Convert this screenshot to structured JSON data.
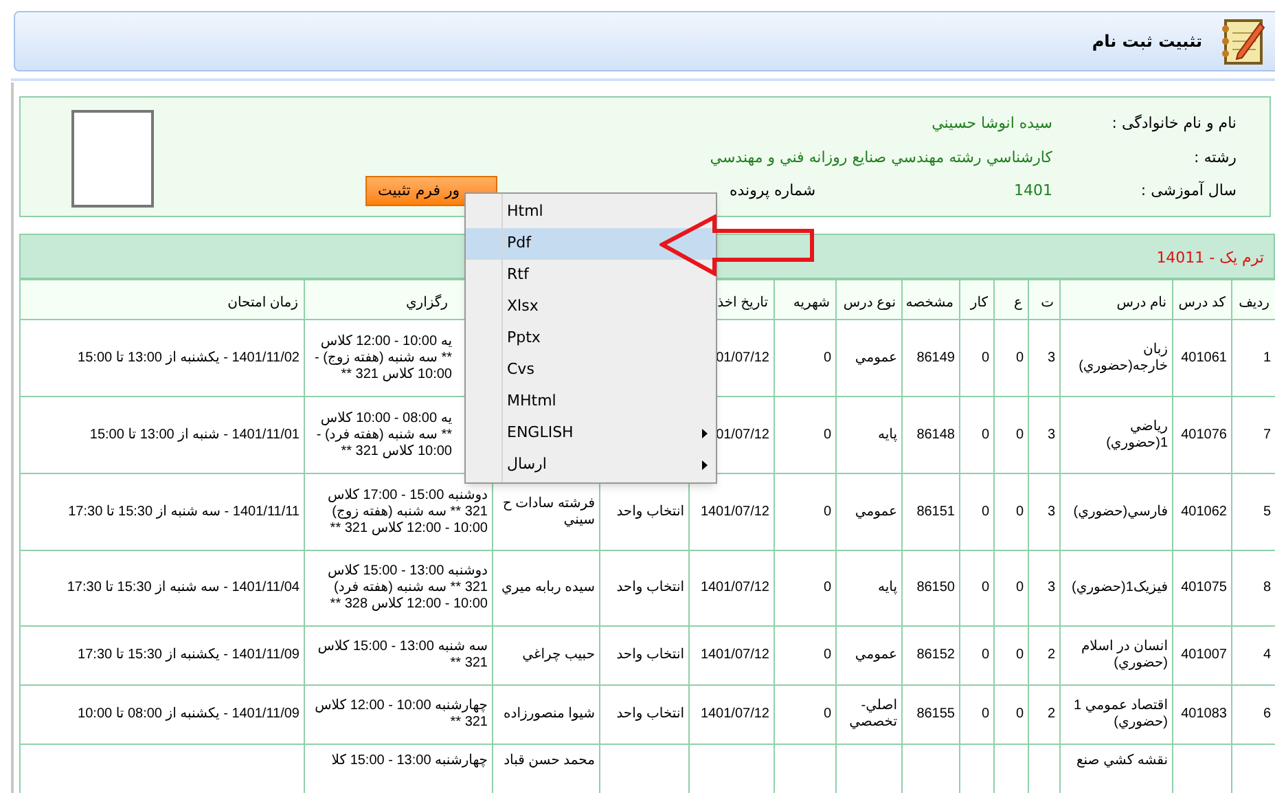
{
  "header": {
    "title": "تثبيت ثبت نام"
  },
  "student": {
    "fields": [
      {
        "label": "نام و نام خانوادگی :",
        "value": "سيده انوشا حسيني"
      },
      {
        "label": "رشته :",
        "value": "كارشناسي رشته مهندسي صنايع روزانه فني و مهندسي"
      },
      {
        "label": "سال آموزشی :",
        "value": "1401"
      },
      {
        "label": "شماره پرونده"
      }
    ],
    "button": "ور فرم تثبيت"
  },
  "term": "ترم يک - 14011",
  "table": {
    "columns": [
      {
        "label": "رديف"
      },
      {
        "label": "کد درس"
      },
      {
        "label": "نام درس"
      },
      {
        "label": "ت"
      },
      {
        "label": "ع"
      },
      {
        "label": "کار"
      },
      {
        "label": "مشخصه"
      },
      {
        "label": "نوع درس"
      },
      {
        "label": "شهريه"
      },
      {
        "label": "تاريخ اخذ"
      },
      {},
      {},
      {
        "label": "رگزاري"
      },
      {
        "label": "زمان امتحان"
      }
    ],
    "rows": [
      [
        "1",
        "401061",
        "زبان خارجه(حضوري)",
        "3",
        "0",
        "0",
        "86149",
        "عمومي",
        "0",
        "01/07/12",
        null,
        null,
        "يه 10:00 - 12:00 كلاس ** سه شنبه (هفته زوج) - 10:00 كلاس 321 **",
        "1401/11/02 - يكشنبه از 13:00 تا 15:00"
      ],
      [
        "7",
        "401076",
        "رياضي 1(حضوري)",
        "3",
        "0",
        "0",
        "86148",
        "پايه",
        "0",
        "01/07/12",
        null,
        null,
        "يه 08:00 - 10:00 كلاس ** سه شنبه (هفته فرد) - 10:00 كلاس 321 **",
        "1401/11/01 - شنبه از 13:00 تا 15:00"
      ],
      [
        "5",
        "401062",
        "فارسي(حضوري)",
        "3",
        "0",
        "0",
        "86151",
        "عمومي",
        "0",
        "1401/07/12",
        "انتخاب واحد",
        "فرشته سادات ح سيني",
        "دوشنبه 15:00 - 17:00 كلاس 321 ** سه شنبه (هفته زوج) 10:00 - 12:00 كلاس 321 **",
        "1401/11/11 - سه شنبه از 15:30 تا 17:30"
      ],
      [
        "8",
        "401075",
        "فيزيک1(حضوري)",
        "3",
        "0",
        "0",
        "86150",
        "پايه",
        "0",
        "1401/07/12",
        "انتخاب واحد",
        "سيده ربابه ميري",
        "دوشنبه 13:00 - 15:00 كلاس 321 ** سه شنبه (هفته فرد) 10:00 - 12:00 كلاس 328 **",
        "1401/11/04 - سه شنبه از 15:30 تا 17:30"
      ],
      [
        "4",
        "401007",
        "انسان در اسلام (حضوري)",
        "2",
        "0",
        "0",
        "86152",
        "عمومي",
        "0",
        "1401/07/12",
        "انتخاب واحد",
        "حبيب چراغي",
        "سه شنبه 13:00 - 15:00 كلاس 321 **",
        "1401/11/09 - يكشنبه از 15:30 تا 17:30"
      ],
      [
        "6",
        "401083",
        "اقتصاد عمومي 1 (حضوري)",
        "2",
        "0",
        "0",
        "86155",
        "اصلي-تخصصي",
        "0",
        "1401/07/12",
        "انتخاب واحد",
        "شيوا منصورزاده",
        "چهارشنبه 10:00 - 12:00 كلاس 321 **",
        "1401/11/09 - يكشنبه از 08:00 تا 10:00"
      ],
      [
        null,
        null,
        "نقشه كشي صنع",
        null,
        null,
        null,
        null,
        null,
        null,
        null,
        null,
        "محمد حسن قباد",
        "چهارشنبه 13:00 - 15:00 كلا",
        null
      ]
    ]
  },
  "menu": {
    "items": [
      {
        "label": "Html",
        "selected": false,
        "submenu": false
      },
      {
        "label": "Pdf",
        "selected": true,
        "submenu": false
      },
      {
        "label": "Rtf",
        "selected": false,
        "submenu": false
      },
      {
        "label": "Xlsx",
        "selected": false,
        "submenu": false
      },
      {
        "label": "Pptx",
        "selected": false,
        "submenu": false
      },
      {
        "label": "Cvs",
        "selected": false,
        "submenu": false
      },
      {
        "label": "MHtml",
        "selected": false,
        "submenu": false
      },
      {
        "label": "ENGLISH",
        "selected": false,
        "submenu": true
      },
      {
        "label": "ارسال",
        "selected": false,
        "submenu": true
      }
    ]
  }
}
